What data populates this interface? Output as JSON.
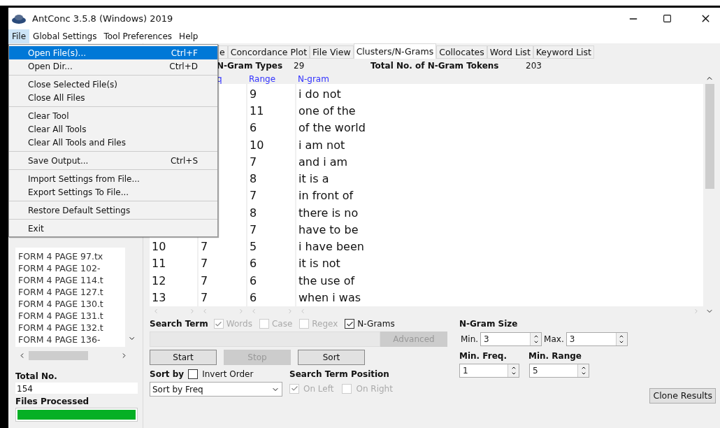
{
  "window": {
    "title": "AntConc 3.5.8 (Windows) 2019"
  },
  "menu_bar": [
    {
      "label": "File",
      "selected": true
    },
    {
      "label": "Global Settings",
      "selected": false
    },
    {
      "label": "Tool Preferences",
      "selected": false
    },
    {
      "label": "Help",
      "selected": false
    }
  ],
  "file_menu": [
    [
      {
        "label": "Open File(s)...",
        "shortcut": "Ctrl+F",
        "selected": true
      },
      {
        "label": "Open Dir...",
        "shortcut": "Ctrl+D",
        "selected": false
      }
    ],
    [
      {
        "label": "Close Selected File(s)",
        "selected": false
      },
      {
        "label": "Close All Files",
        "selected": false
      }
    ],
    [
      {
        "label": "Clear Tool",
        "selected": false
      },
      {
        "label": "Clear All Tools",
        "selected": false
      },
      {
        "label": "Clear All Tools and Files",
        "selected": false
      }
    ],
    [
      {
        "label": "Save Output...",
        "shortcut": "Ctrl+S",
        "selected": false
      }
    ],
    [
      {
        "label": "Import Settings from File...",
        "selected": false
      },
      {
        "label": "Export Settings To File...",
        "selected": false
      }
    ],
    [
      {
        "label": "Restore Default Settings",
        "selected": false
      }
    ],
    [
      {
        "label": "Exit",
        "selected": false
      }
    ]
  ],
  "corpus_files": [
    "FORM 4 PAGE 97.tx",
    "FORM 4 PAGE 102-",
    "FORM 4 PAGE 114.t",
    "FORM 4 PAGE 127.t",
    "FORM 4 PAGE 130.t",
    "FORM 4 PAGE 131.t",
    "FORM 4 PAGE 132.t",
    "FORM 4 PAGE 136-"
  ],
  "total_no": {
    "label": "Total No.",
    "value": "154"
  },
  "files_processed": {
    "label": "Files Processed",
    "level": 1
  },
  "tabs": [
    {
      "label": "e",
      "selected": false
    },
    {
      "label": "Concordance Plot",
      "selected": false
    },
    {
      "label": "File View",
      "selected": false
    },
    {
      "label": "Clusters/N-Grams",
      "selected": true
    },
    {
      "label": "Collocates",
      "selected": false
    },
    {
      "label": "Word List",
      "selected": false
    },
    {
      "label": "Keyword List",
      "selected": false
    }
  ],
  "stats": [
    {
      "label": "N-Gram Types",
      "value": "29"
    },
    {
      "label": "Total No. of N-Gram Tokens",
      "value": "203"
    }
  ],
  "table": {
    "columns": [
      "q",
      "Range",
      "N-gram"
    ],
    "rows": [
      {
        "range": "9",
        "ngram": "i do not"
      },
      {
        "range": "11",
        "ngram": "one of the"
      },
      {
        "range": "6",
        "ngram": "of the world"
      },
      {
        "range": "10",
        "ngram": "i am not"
      },
      {
        "range": "7",
        "ngram": "and i am"
      },
      {
        "range": "8",
        "ngram": "it is a"
      },
      {
        "range": "7",
        "ngram": "in front of"
      },
      {
        "range": "8",
        "ngram": "there is no"
      },
      {
        "range": "7",
        "ngram": "have to be"
      },
      {
        "rank": "10",
        "freq": "7",
        "range": "5",
        "ngram": "i have been"
      },
      {
        "rank": "11",
        "freq": "7",
        "range": "6",
        "ngram": "it is not"
      },
      {
        "rank": "12",
        "freq": "7",
        "range": "6",
        "ngram": "the use of"
      },
      {
        "rank": "13",
        "freq": "7",
        "range": "6",
        "ngram": "when i was"
      }
    ]
  },
  "search": {
    "label": "Search Term",
    "options": [
      {
        "label": "Words",
        "checked": true,
        "disabled": true
      },
      {
        "label": "Case",
        "checked": false,
        "disabled": true
      },
      {
        "label": "Regex",
        "checked": false,
        "disabled": true
      },
      {
        "label": "N-Grams",
        "checked": true,
        "disabled": false
      }
    ],
    "advanced": {
      "label": "Advanced",
      "disabled": true
    }
  },
  "buttons": [
    {
      "label": "Start",
      "disabled": false
    },
    {
      "label": "Stop",
      "disabled": true
    },
    {
      "label": "Sort",
      "disabled": false
    }
  ],
  "sort": {
    "label": "Sort by",
    "invert": {
      "label": "Invert Order",
      "checked": false
    },
    "value": "Sort by Freq"
  },
  "search_term_position": {
    "label": "Search Term Position",
    "options": [
      {
        "label": "On Left",
        "checked": true,
        "disabled": true
      },
      {
        "label": "On Right",
        "checked": false,
        "disabled": true
      }
    ]
  },
  "ngram_size": {
    "label": "N-Gram Size",
    "min": {
      "label": "Min.",
      "value": "3"
    },
    "max": {
      "label": "Max.",
      "value": "3"
    }
  },
  "min_freq": {
    "label": "Min. Freq.",
    "value": "1"
  },
  "min_range": {
    "label": "Min. Range",
    "value": "5"
  },
  "clone_button": "Clone Results"
}
